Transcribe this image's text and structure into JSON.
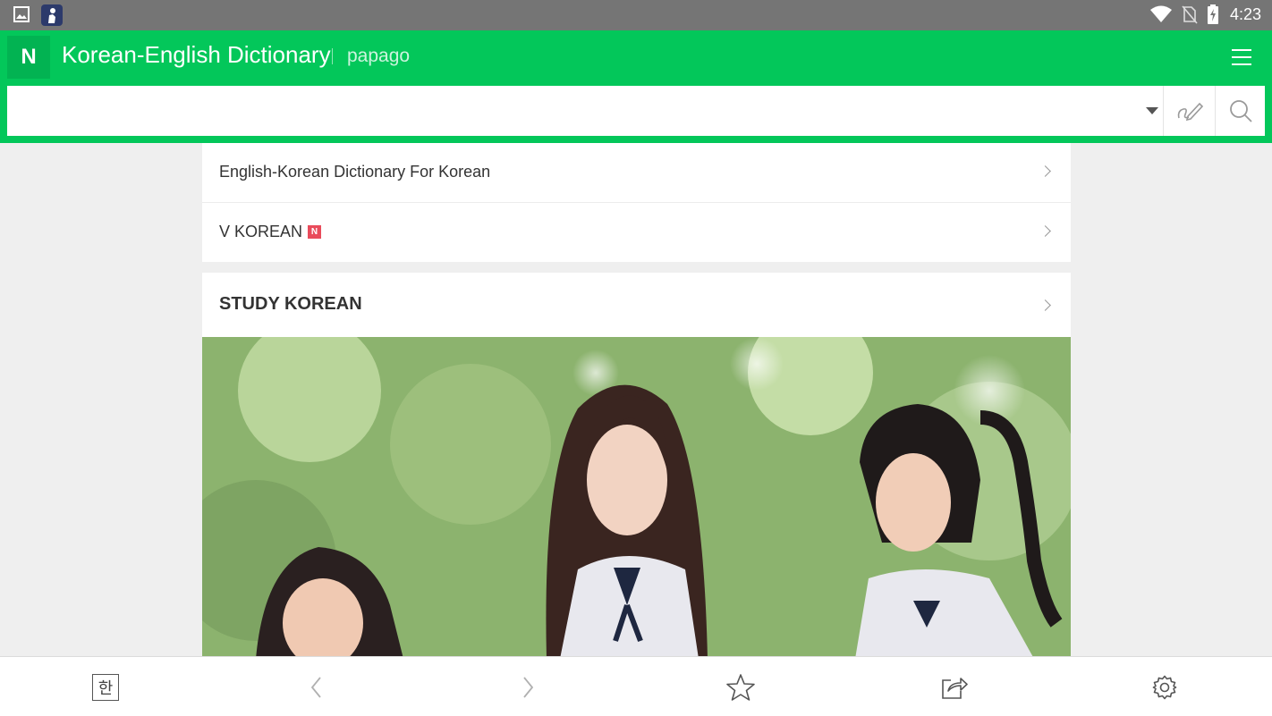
{
  "status_bar": {
    "time": "4:23",
    "left_icons": [
      "image-icon",
      "app-notification-icon"
    ],
    "right_icons": [
      "wifi-icon",
      "no-sim-icon",
      "battery-charging-icon"
    ]
  },
  "header": {
    "logo_text": "N",
    "title": "Korean-English Dictionary",
    "subtitle": "papago",
    "accent_color": "#03c75a"
  },
  "search": {
    "value": "",
    "placeholder": ""
  },
  "menu_items": [
    {
      "label": "English-Korean Dictionary For Korean",
      "badge": ""
    },
    {
      "label": "V KOREAN",
      "badge": "N"
    }
  ],
  "study_section": {
    "title": "STUDY KOREAN"
  },
  "bottom_bar": {
    "korean_button_label": "한",
    "icons": [
      "hangul-keyboard-icon",
      "back-icon",
      "forward-icon",
      "star-icon",
      "share-icon",
      "settings-icon"
    ]
  }
}
